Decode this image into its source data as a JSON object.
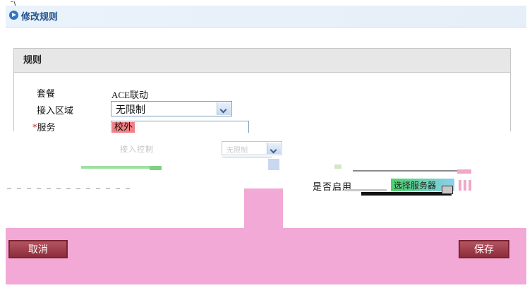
{
  "header": {
    "title": "修改规则",
    "corner_mark": "ˉ\\"
  },
  "panel": {
    "title": "规则",
    "rows": [
      {
        "label": "套餐",
        "value": "ACE联动"
      },
      {
        "label": "接入区域",
        "value": "无限制"
      },
      {
        "label": "服务",
        "required_mark": "*",
        "value": "校外"
      }
    ]
  },
  "corrupted": {
    "access_control_label": "接入控制",
    "access_control_value": "无限制",
    "enable_label": "是否启用",
    "select_label": "选择服务器"
  },
  "footer": {
    "cancel_label": "取消",
    "save_label": "保存"
  },
  "colors": {
    "title": "#21548e",
    "footer_bg": "#f2a9d5",
    "button": "#9b3a48",
    "tag": "#f07f86"
  }
}
